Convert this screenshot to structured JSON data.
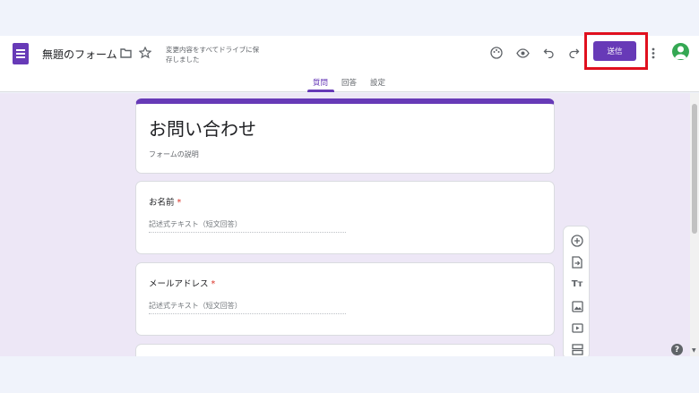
{
  "header": {
    "doc_title": "無題のフォーム",
    "save_status": "変更内容をすべてドライブに保存しました",
    "send_label": "送信",
    "icons": [
      "forms-icon",
      "folder-icon",
      "star-icon",
      "palette-icon",
      "preview-eye-icon",
      "undo-icon",
      "redo-icon",
      "more-vert-icon",
      "avatar"
    ]
  },
  "tabs": [
    {
      "label": "質問",
      "active": true
    },
    {
      "label": "回答",
      "active": false
    },
    {
      "label": "設定",
      "active": false
    }
  ],
  "form": {
    "title": "お問い合わせ",
    "description": "フォームの説明",
    "questions": [
      {
        "title": "お名前",
        "required_mark": "*",
        "answer_placeholder": "記述式テキスト（短文回答）"
      },
      {
        "title": "メールアドレス",
        "required_mark": "*",
        "answer_placeholder": "記述式テキスト（短文回答）"
      }
    ]
  },
  "toolbar": {
    "icons": [
      "add-question-icon",
      "import-questions-icon",
      "add-title-icon",
      "add-image-icon",
      "add-video-icon",
      "add-section-icon"
    ],
    "title_glyph": "Tт"
  },
  "help_glyph": "?",
  "colors": {
    "accent": "#673ab7",
    "highlight": "#e0101e",
    "background": "#ede7f6"
  }
}
